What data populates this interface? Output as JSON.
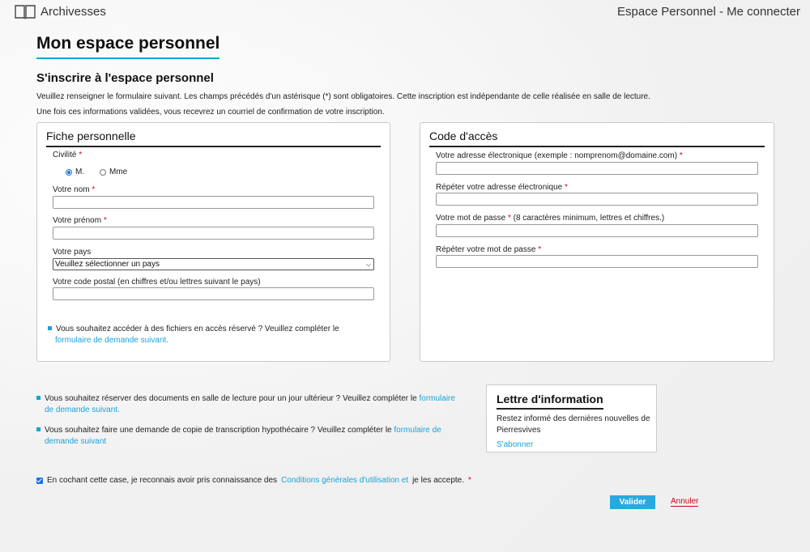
{
  "header": {
    "logo_text": "Archivesses",
    "account_link": "Espace Personnel - Me connecter"
  },
  "page": {
    "title": "Mon espace personnel",
    "section_title": "S'inscrire à l'espace personnel",
    "intro_1": "Veuillez renseigner le formulaire suivant. Les champs précédés d'un astérisque (*) sont obligatoires. Cette inscription est indépendante de celle réalisée en salle de lecture.",
    "intro_2": "Une fois ces informations validées, vous recevrez un courriel de confirmation de votre inscription."
  },
  "fiche": {
    "legend": "Fiche personnelle",
    "civilite_label": "Civilité",
    "civilite_options": [
      "M.",
      "Mme"
    ],
    "civilite_selected": "M.",
    "nom_label": "Votre nom",
    "nom_value": "",
    "prenom_label": "Votre prénom",
    "prenom_value": "",
    "pays_label": "Votre pays",
    "pays_selected": "Veuillez sélectionner un pays",
    "cp_label": "Votre code postal (en chiffres et/ou lettres suivant le pays)",
    "cp_value": "",
    "reserve_text": "Vous souhaitez accéder à des fichiers en accès réservé ? Veuillez compléter le",
    "reserve_link": "formulaire de demande suivant."
  },
  "acces": {
    "legend": "Code d'accès",
    "email_label": "Votre adresse électronique (exemple : nomprenom@domaine.com)",
    "email2_label": "Répéter votre adresse électronique",
    "pwd_label": "Votre mot de passe",
    "pwd_hint": "(8 caractères minimum, lettres et chiffres.)",
    "pwd2_label": "Répéter votre mot de passe"
  },
  "extra": {
    "reservation_text": "Vous souhaitez réserver des documents en salle de lecture pour un jour ultérieur ? Veuillez compléter le",
    "reservation_link_1": "formulaire",
    "reservation_link_2": "de demande suivant.",
    "copie_text": "Vous souhaitez faire une demande de copie de transcription hypothécaire ? Veuillez compléter le",
    "copie_link_1": "formulaire de",
    "copie_link_2": "demande suivant"
  },
  "newsletter": {
    "title": "Lettre d'information",
    "text": "Restez informé des dernières nouvelles de Pierresvives",
    "link": "S'abonner"
  },
  "cgu": {
    "checked": true,
    "text_before": "En cochant cette case, je reconnais avoir pris connaissance des",
    "link": "Conditions générales d'utilisation et",
    "text_after": "je les accepte."
  },
  "actions": {
    "submit": "Valider",
    "cancel": "Annuler"
  },
  "colors": {
    "accent": "#29a9df",
    "required": "#d0021b"
  }
}
